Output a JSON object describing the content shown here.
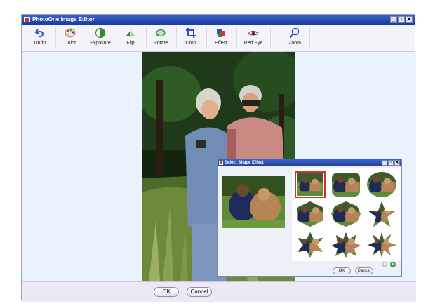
{
  "app": {
    "title": "PhotoOne Image Editor"
  },
  "window_buttons": [
    "_",
    "▫",
    "✕"
  ],
  "toolbar": {
    "items": [
      {
        "label": "Undo",
        "icon": "undo-icon"
      },
      {
        "label": "Color",
        "icon": "palette-icon"
      },
      {
        "label": "Exposure",
        "icon": "exposure-icon"
      },
      {
        "label": "Flip",
        "icon": "flip-icon"
      },
      {
        "label": "Rotate",
        "icon": "rotate-icon"
      },
      {
        "label": "Crop",
        "icon": "crop-icon"
      },
      {
        "label": "Effect",
        "icon": "effect-icon"
      },
      {
        "label": "Red Eye",
        "icon": "red-eye-icon"
      },
      {
        "label": "Zoom",
        "icon": "zoom-icon"
      }
    ]
  },
  "footer": {
    "ok": "OK",
    "cancel": "Cancel"
  },
  "dialog": {
    "title": "Select Shape Effect",
    "shapes": [
      "rectangle",
      "rounded-rectangle",
      "ellipse",
      "hexagon",
      "octagon",
      "star-5",
      "star-6",
      "star-7",
      "star-8"
    ],
    "selected_shape": "rectangle",
    "ok": "OK",
    "cancel": "Cancel",
    "prev_icon": "arrow-left-icon",
    "next_icon": "arrow-right-icon"
  },
  "colors": {
    "title_bar": "#1f42a8",
    "workspace": "#eaf2fd",
    "selection": "#c8352b"
  }
}
